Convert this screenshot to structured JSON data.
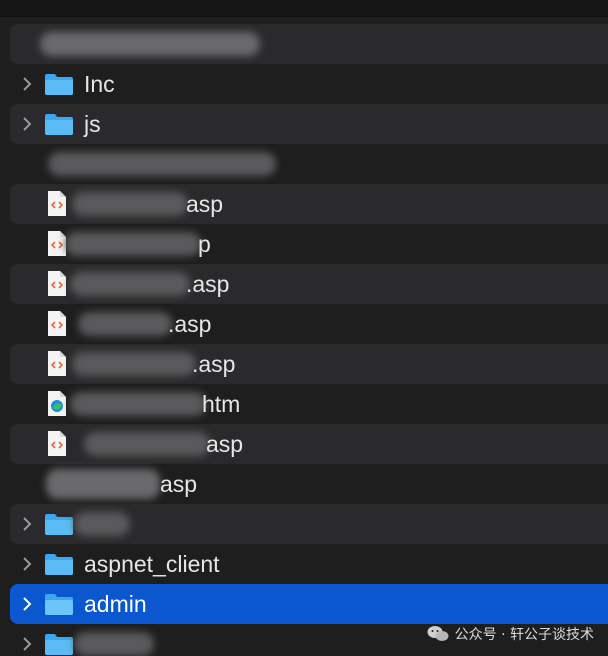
{
  "rows": [
    {
      "type": "redacted"
    },
    {
      "type": "folder",
      "label": "Inc"
    },
    {
      "type": "folder",
      "label": "js"
    },
    {
      "type": "redacted"
    },
    {
      "type": "file",
      "suffix": "asp"
    },
    {
      "type": "file",
      "suffix": "p"
    },
    {
      "type": "file",
      "suffix": ".asp"
    },
    {
      "type": "file",
      "suffix": ".asp"
    },
    {
      "type": "file",
      "suffix": ".asp"
    },
    {
      "type": "file",
      "suffix": "htm"
    },
    {
      "type": "file",
      "suffix": "asp"
    },
    {
      "type": "file",
      "suffix": "asp"
    },
    {
      "type": "folder",
      "label": ""
    },
    {
      "type": "folder",
      "label": "aspnet_client"
    },
    {
      "type": "folder",
      "label": "admin"
    },
    {
      "type": "folder",
      "label": ""
    }
  ],
  "watermark": {
    "text": "公众号 · 轩公子谈技术"
  },
  "colors": {
    "selection": "#0b57d0",
    "folder": "#3aa7ee",
    "stripe": "#2a2a2c"
  }
}
